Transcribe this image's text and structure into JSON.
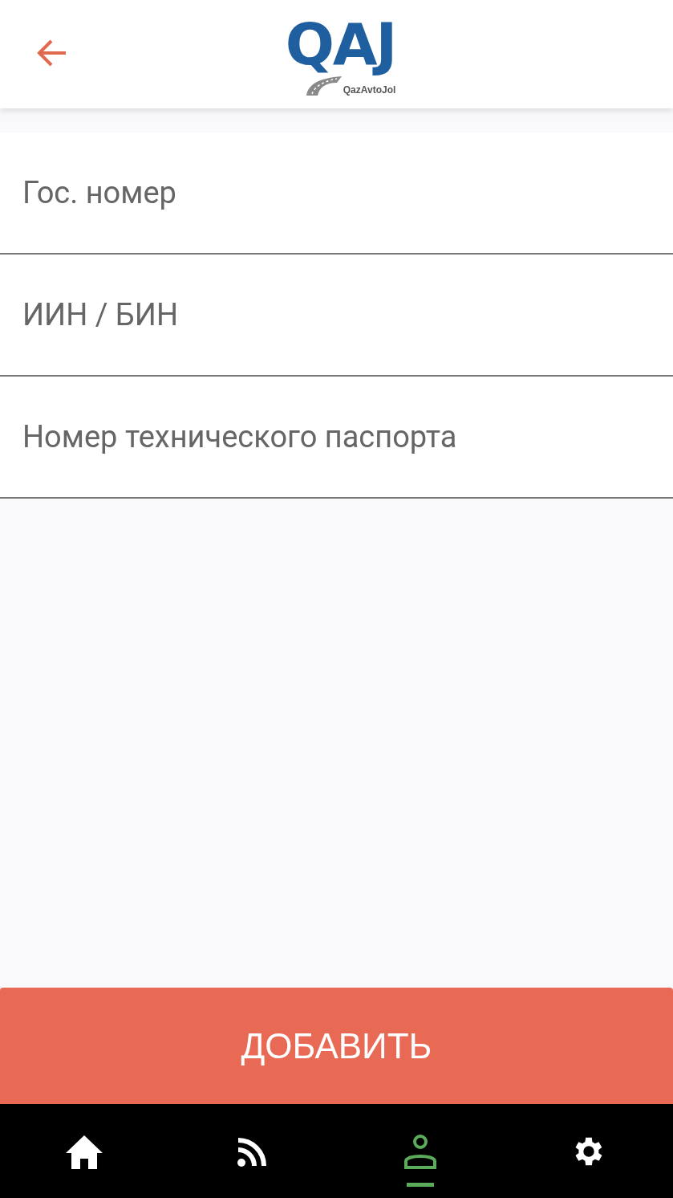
{
  "header": {
    "logo": {
      "mark": "QAJ",
      "name": "QazAvtoJol"
    }
  },
  "fields": [
    {
      "placeholder": "Гос. номер"
    },
    {
      "placeholder": "ИИН / БИН"
    },
    {
      "placeholder": "Номер технического паспорта"
    }
  ],
  "submit_button": {
    "label": "ДОБАВИТЬ"
  },
  "bottom_nav": [
    {
      "kind": "home",
      "selected": false
    },
    {
      "kind": "feed",
      "selected": false
    },
    {
      "kind": "profile",
      "selected": true
    },
    {
      "kind": "settings",
      "selected": false
    }
  ]
}
